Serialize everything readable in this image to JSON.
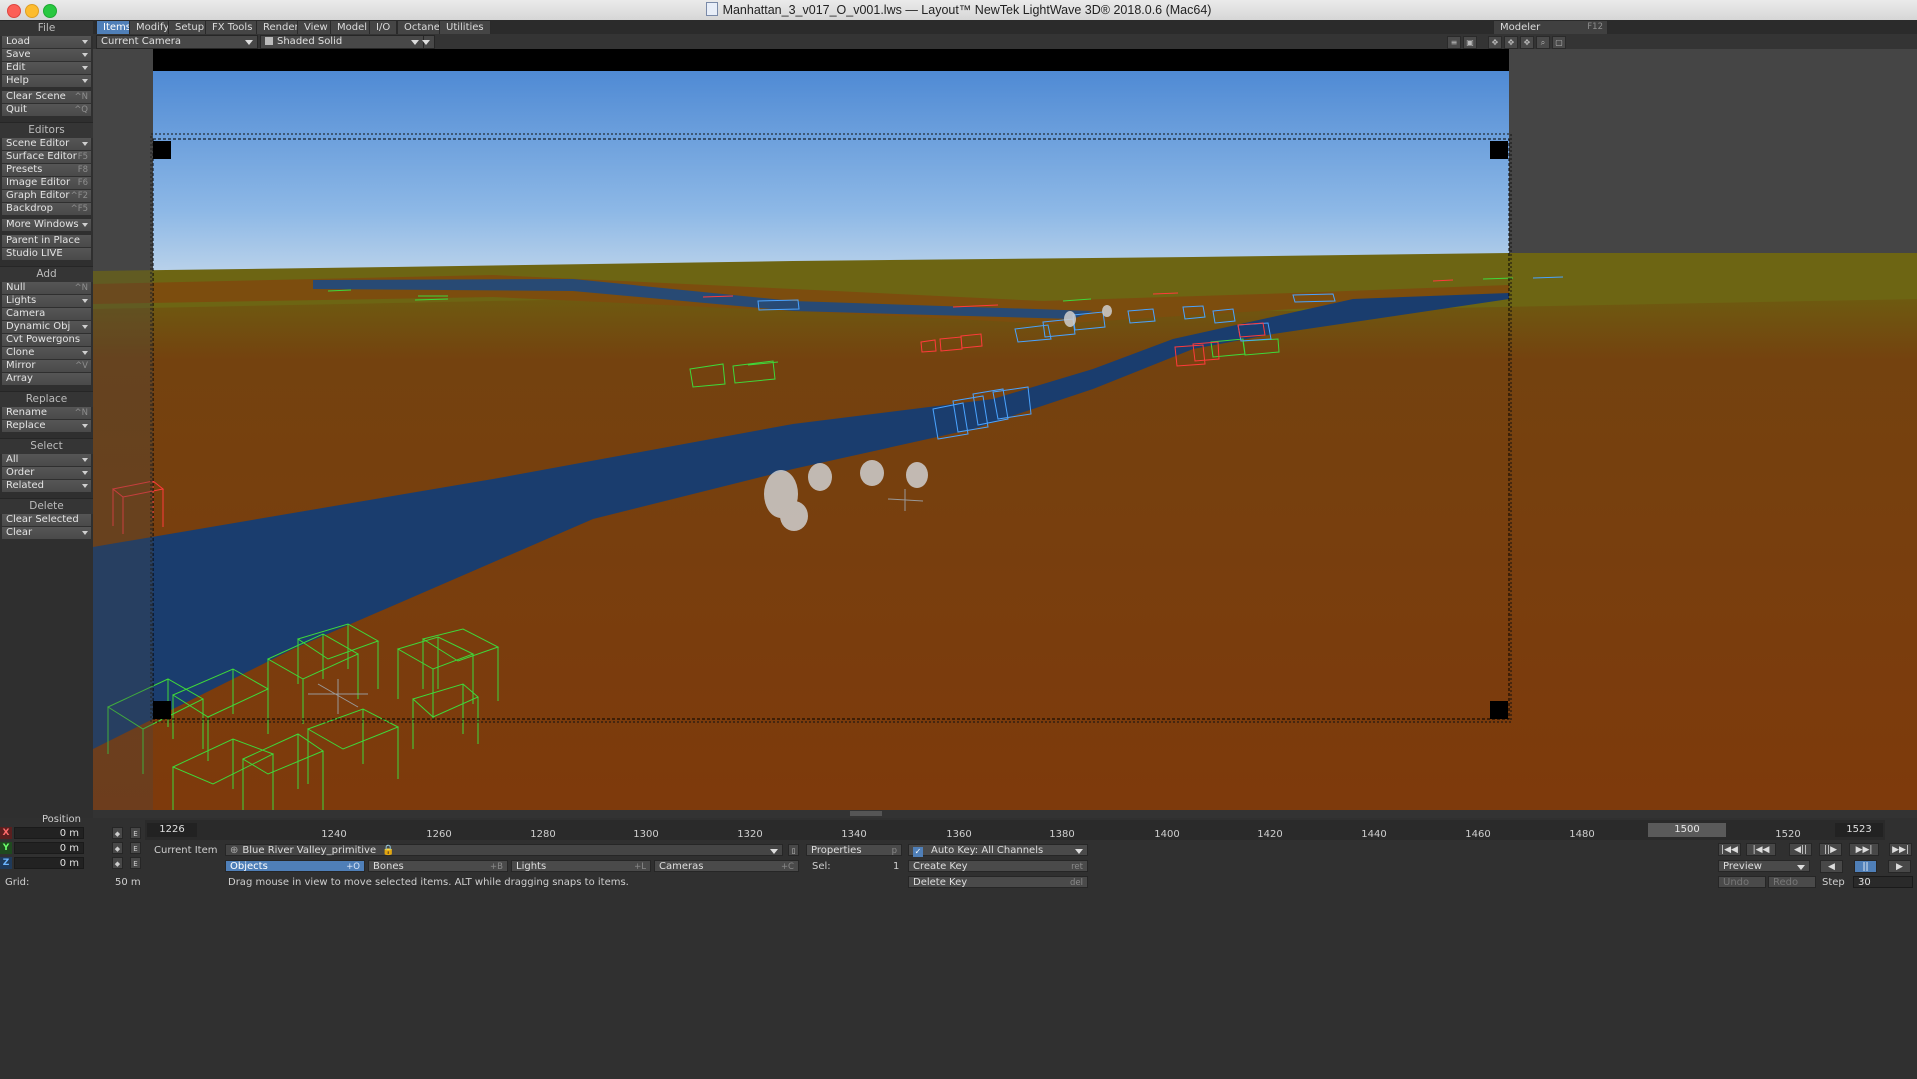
{
  "window": {
    "title": "Manhattan_3_v017_O_v001.lws — Layout™ NewTek LightWave 3D® 2018.0.6 (Mac64)"
  },
  "sidebar": {
    "sections": [
      {
        "title": "File",
        "items": [
          {
            "label": "Load",
            "shortcut": "",
            "dropdown": true
          },
          {
            "label": "Save",
            "shortcut": "",
            "dropdown": true
          },
          {
            "label": "Edit",
            "shortcut": "",
            "dropdown": true
          },
          {
            "label": "Help",
            "shortcut": "",
            "dropdown": true
          },
          {
            "gap": true
          },
          {
            "label": "Clear Scene",
            "shortcut": "^N",
            "dropdown": false
          },
          {
            "label": "Quit",
            "shortcut": "^Q",
            "dropdown": false
          }
        ]
      },
      {
        "title": "Editors",
        "items": [
          {
            "label": "Scene Editor",
            "shortcut": "",
            "dropdown": true
          },
          {
            "label": "Surface Editor",
            "shortcut": "F5",
            "dropdown": false
          },
          {
            "label": "Presets",
            "shortcut": "F8",
            "dropdown": false
          },
          {
            "label": "Image Editor",
            "shortcut": "F6",
            "dropdown": false
          },
          {
            "label": "Graph Editor",
            "shortcut": "^F2",
            "dropdown": false
          },
          {
            "label": "Backdrop",
            "shortcut": "^F5",
            "dropdown": false
          },
          {
            "gap": true
          },
          {
            "label": "More Windows",
            "shortcut": "",
            "dropdown": true
          },
          {
            "gap": true
          },
          {
            "label": "Parent in Place",
            "shortcut": "",
            "dropdown": false
          },
          {
            "label": "Studio LIVE",
            "shortcut": "",
            "dropdown": false
          }
        ]
      },
      {
        "title": "Add",
        "items": [
          {
            "label": "Null",
            "shortcut": "^N",
            "dropdown": false
          },
          {
            "label": "Lights",
            "shortcut": "",
            "dropdown": true
          },
          {
            "label": "Camera",
            "shortcut": "",
            "dropdown": false
          },
          {
            "label": "Dynamic Obj",
            "shortcut": "",
            "dropdown": true
          },
          {
            "label": "Cvt Powergons",
            "shortcut": "",
            "dropdown": false
          },
          {
            "label": "Clone",
            "shortcut": "",
            "dropdown": true
          },
          {
            "label": "Mirror",
            "shortcut": "^V",
            "dropdown": false
          },
          {
            "label": "Array",
            "shortcut": "",
            "dropdown": false
          }
        ]
      },
      {
        "title": "Replace",
        "items": [
          {
            "label": "Rename",
            "shortcut": "^N",
            "dropdown": false
          },
          {
            "label": "Replace",
            "shortcut": "",
            "dropdown": true
          }
        ]
      },
      {
        "title": "Select",
        "items": [
          {
            "label": "All",
            "shortcut": "",
            "dropdown": true
          },
          {
            "label": "Order",
            "shortcut": "",
            "dropdown": true
          },
          {
            "label": "Related",
            "shortcut": "",
            "dropdown": true
          }
        ]
      },
      {
        "title": "Delete",
        "items": [
          {
            "label": "Clear Selected",
            "shortcut": "",
            "dropdown": false
          },
          {
            "label": "Clear",
            "shortcut": "",
            "dropdown": true
          }
        ]
      }
    ]
  },
  "tabs": [
    "Items",
    "Modify",
    "Setup",
    "FX Tools",
    "Render",
    "View",
    "Model",
    "I/O",
    "Octane",
    "Utilities"
  ],
  "active_tab": "Items",
  "modeler": {
    "label": "Modeler",
    "shortcut": "F12"
  },
  "viewport": {
    "camera_select": "Current Camera",
    "render_mode": "Shaded Solid"
  },
  "position": {
    "label": "Position",
    "x": {
      "axis": "X",
      "value": "0 m"
    },
    "y": {
      "axis": "Y",
      "value": "0 m"
    },
    "z": {
      "axis": "Z",
      "value": "0 m"
    }
  },
  "timeline": {
    "start": "1226",
    "end": "1523",
    "current": "1500",
    "ticks": [
      "1240",
      "1260",
      "1280",
      "1300",
      "1320",
      "1340",
      "1360",
      "1380",
      "1400",
      "1420",
      "1440",
      "1460",
      "1480",
      "1520"
    ]
  },
  "current_item": {
    "label": "Current Item",
    "value": "Blue River Valley_primitive"
  },
  "item_types": [
    {
      "label": "Objects",
      "shortcut": "+O"
    },
    {
      "label": "Bones",
      "shortcut": "+B"
    },
    {
      "label": "Lights",
      "shortcut": "+L"
    },
    {
      "label": "Cameras",
      "shortcut": "+C"
    }
  ],
  "properties": {
    "label": "Properties",
    "shortcut": "p"
  },
  "sel": {
    "label": "Sel:",
    "value": "1"
  },
  "autokey": {
    "label": "Auto Key: All Channels"
  },
  "create_key": {
    "label": "Create Key",
    "shortcut": "ret"
  },
  "delete_key": {
    "label": "Delete Key",
    "shortcut": "del"
  },
  "preview": {
    "label": "Preview"
  },
  "undo": "Undo",
  "redo": "Redo",
  "step": {
    "label": "Step",
    "value": "30"
  },
  "grid": {
    "label": "Grid:",
    "value": "50 m"
  },
  "status": "Drag mouse in view to move selected items. ALT while dragging snaps to items.",
  "colors": {
    "accent": "#4f7fb8",
    "ground": "#7a3c10",
    "water": "#1a3d6e",
    "sky": "#5a95d6"
  }
}
